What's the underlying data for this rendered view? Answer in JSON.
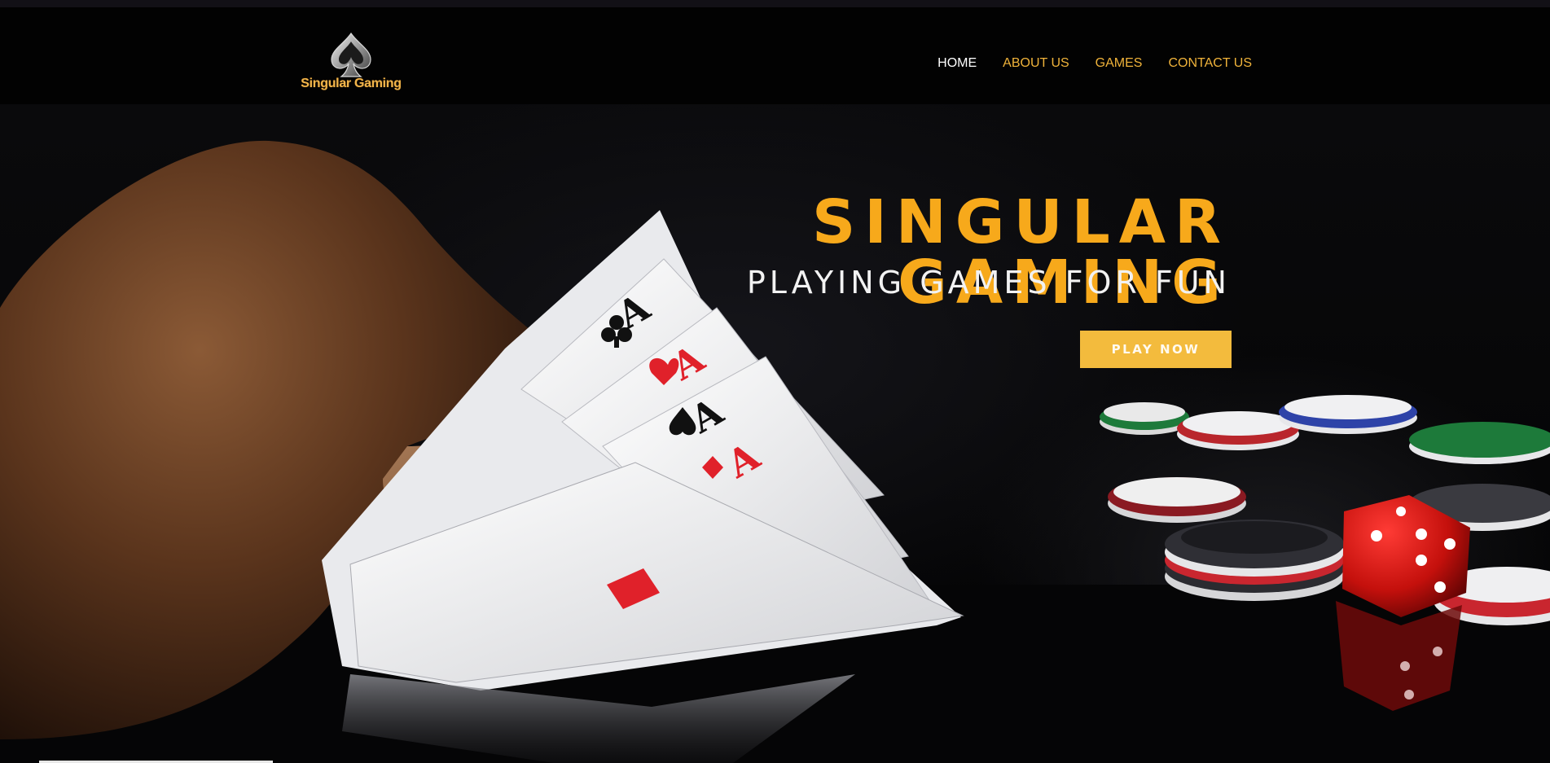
{
  "brand": {
    "logo_text": "Singular Gaming",
    "logo_icon": "spade-icon"
  },
  "nav": {
    "items": [
      {
        "label": "HOME",
        "active": true
      },
      {
        "label": "ABOUT US",
        "active": false
      },
      {
        "label": "GAMES",
        "active": false
      },
      {
        "label": "CONTACT US",
        "active": false
      }
    ]
  },
  "hero": {
    "title": "SINGULAR GAMING",
    "subtitle": "PLAYING GAMES FOR FUN",
    "cta_label": "PLAY NOW",
    "card_rank": "A"
  },
  "colors": {
    "accent": "#f7a91b",
    "nav_link": "#f0b33a",
    "button": "#f3bb3d",
    "header_bg": "#020202",
    "card_red": "#e0212a"
  }
}
